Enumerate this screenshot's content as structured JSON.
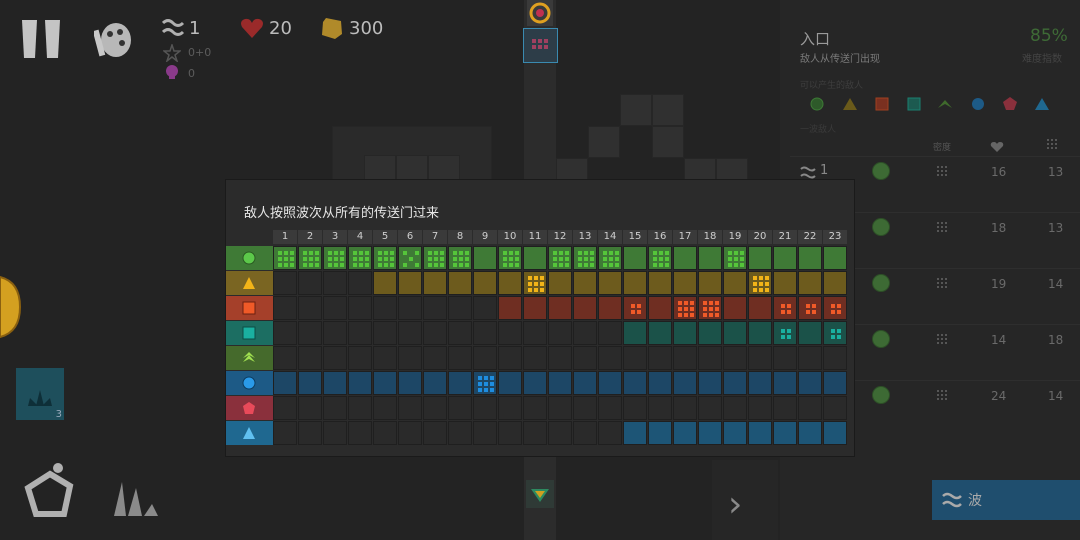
{
  "hud": {
    "wave_value": "1",
    "stars_value": "0+0",
    "skulls_value": "0",
    "lives_value": "20",
    "coins_value": "300",
    "wave_icon": "waves-icon",
    "star_icon": "star-icon",
    "skull_icon": "skull-icon",
    "heart_icon": "heart-icon",
    "coin_icon": "coin-icon",
    "pause_icon": "pause-icon",
    "palette_icon": "palette-icon"
  },
  "colors": {
    "green": "#3f7a36",
    "yellow": "#7a6522",
    "red": "#7a3224",
    "teal": "#1c5a50",
    "olive": "#405f2c",
    "blue": "#1d4a6e",
    "pink": "#7a2a32",
    "lightblue": "#1f5a7a"
  },
  "right_panel": {
    "title": "入口",
    "subtitle": "敌人从传送门出现",
    "percent": "85%",
    "percent_label": "难度指数",
    "enemies_label": "可以产生的敌人",
    "wave_label": "一波敌人",
    "col_density_icon": "density-icon",
    "col_health_icon": "heart-icon",
    "col_count_icon": "count-icon",
    "density_label": "密度",
    "rows": [
      {
        "label": "1",
        "health": "16",
        "count": "13"
      },
      {
        "label": "",
        "health": "18",
        "count": "13"
      },
      {
        "label": "",
        "health": "19",
        "count": "14"
      },
      {
        "label": "",
        "health": "14",
        "count": "18"
      },
      {
        "label": "",
        "health": "24",
        "count": "14"
      }
    ]
  },
  "popup": {
    "title": "敌人按照波次从所有的传送门过来",
    "columns": [
      "1",
      "2",
      "3",
      "4",
      "5",
      "6",
      "7",
      "8",
      "9",
      "10",
      "11",
      "12",
      "13",
      "14",
      "15",
      "16",
      "17",
      "18",
      "19",
      "20",
      "21",
      "22",
      "23"
    ],
    "rows": [
      {
        "name": "green-circle-enemy",
        "color": "#3f7a36",
        "bright": "#55c53a",
        "start": 1,
        "end": 23,
        "marks": [
          1,
          2,
          3,
          4,
          5,
          6,
          7,
          8,
          10,
          12,
          13,
          14,
          16,
          19
        ],
        "dotstyle": {
          "6": "5"
        }
      },
      {
        "name": "yellow-triangle-enemy",
        "color": "#6d5b1d",
        "bright": "#f2b418",
        "start": 5,
        "end": 23,
        "marks": [
          11,
          20
        ]
      },
      {
        "name": "red-square-enemy",
        "color": "#6f2e22",
        "bright": "#f05a28",
        "start": 10,
        "end": 23,
        "marks": [
          15,
          17,
          18,
          21,
          22,
          23
        ],
        "dotstyle": {
          "15": "4",
          "21": "4",
          "22": "4",
          "23": "4"
        }
      },
      {
        "name": "teal-square-enemy",
        "color": "#1b5249",
        "bright": "#1ab0a0",
        "start": 15,
        "end": 23,
        "marks": [
          21,
          23
        ],
        "dotstyle": {
          "21": "4",
          "23": "4"
        }
      },
      {
        "name": "olive-chevron-enemy",
        "color": "#3b5a27",
        "bright": "#7fc241",
        "start": 99,
        "end": 0,
        "marks": []
      },
      {
        "name": "blue-circle-enemy",
        "color": "#1d4766",
        "bright": "#1e8de0",
        "start": 1,
        "end": 23,
        "marks": [
          9
        ]
      },
      {
        "name": "pink-pentagon-enemy",
        "color": "#6c2630",
        "bright": "#e04a5a",
        "start": 99,
        "end": 0,
        "marks": []
      },
      {
        "name": "lightblue-triangle-enemy",
        "color": "#1d5576",
        "bright": "#3aa8e0",
        "start": 15,
        "end": 23,
        "marks": []
      }
    ],
    "row_label_colors": [
      "#3f7a36",
      "#7a6522",
      "#a5402a",
      "#1c6e62",
      "#456a2c",
      "#1d5a86",
      "#8a303c",
      "#1f6890"
    ]
  },
  "bottom": {
    "wave_button_label": "波",
    "wave_button_icon": "waves-icon",
    "next_icon": "chevron-right-icon",
    "tower_badge": "3",
    "build_icon": "pentagon-build-icon",
    "upgrade_icon": "wrench-icon"
  }
}
